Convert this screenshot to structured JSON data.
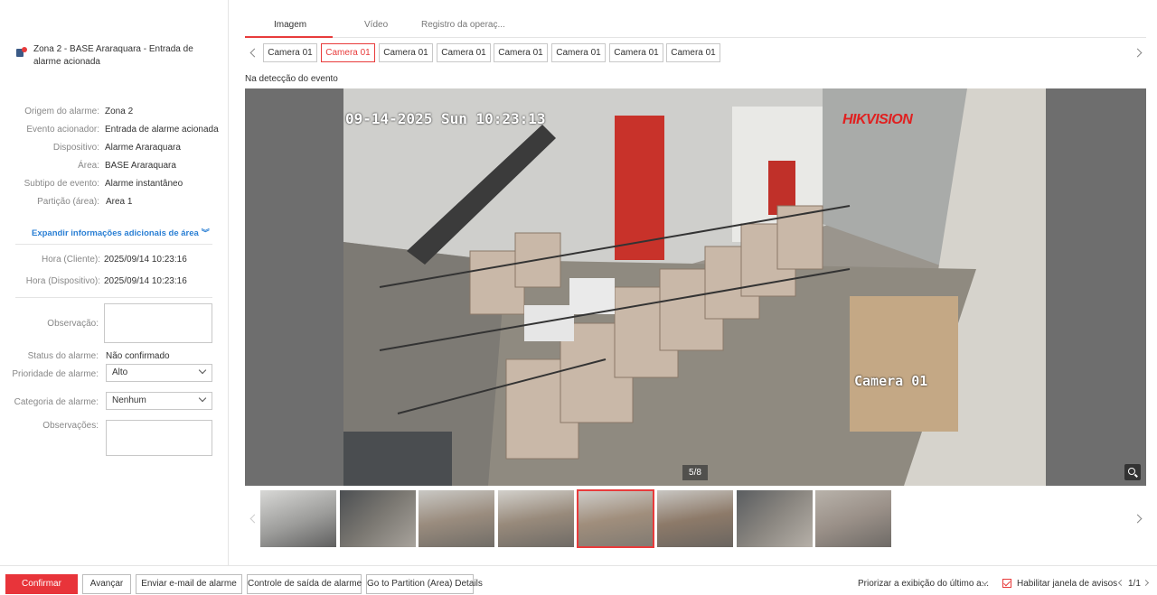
{
  "alarm": {
    "title": "Zona 2 - BASE Araraquara - Entrada de alarme acionada",
    "details": [
      {
        "label": "Origem do alarme:",
        "value": "Zona 2"
      },
      {
        "label": "Evento acionador:",
        "value": "Entrada de alarme acionada"
      },
      {
        "label": "Dispositivo:",
        "value": "Alarme Araraquara"
      },
      {
        "label": "Área:",
        "value": "BASE Araraquara"
      },
      {
        "label": "Subtipo de evento:",
        "value": "Alarme instantâneo"
      },
      {
        "label": "Partição (área):",
        "value": "Area 1"
      }
    ],
    "expand_label": "Expandir informações adicionais de área",
    "times": [
      {
        "label": "Hora (Cliente):",
        "value": "2025/09/14 10:23:16"
      },
      {
        "label": "Hora (Dispositivo):",
        "value": "2025/09/14 10:23:16"
      }
    ]
  },
  "form": {
    "observacao_label": "Observação:",
    "status_label": "Status do alarme:",
    "status_value": "Não confirmado",
    "priority_label": "Prioridade de alarme:",
    "priority_value": "Alto",
    "category_label": "Categoria de alarme:",
    "category_value": "Nenhum",
    "observacoes_label": "Observações:"
  },
  "tabs": [
    "Imagem",
    "Vídeo",
    "Registro da operaç..."
  ],
  "cameras": [
    "Camera 01",
    "Camera 01",
    "Camera 01",
    "Camera 01",
    "Camera 01",
    "Camera 01",
    "Camera 01",
    "Camera 01"
  ],
  "detection_label": "Na detecção do evento",
  "image": {
    "osd_time": "09-14-2025 Sun 10:23:13",
    "osd_camera": "Camera 01",
    "osd_logo": "HIKVISION",
    "counter": "5/8"
  },
  "bottom": {
    "confirm": "Confirmar",
    "advance": "Avançar",
    "email": "Enviar e-mail de alarme",
    "output": "Controle de saída de alarme",
    "partition": "Go to Partition (Area) Details",
    "priority_display": "Priorizar a exibição do último a...",
    "enable_window": "Habilitar janela de avisos",
    "pages": "1/1"
  },
  "colors": {
    "accent": "#e8343a",
    "link": "#2a7fd4"
  }
}
